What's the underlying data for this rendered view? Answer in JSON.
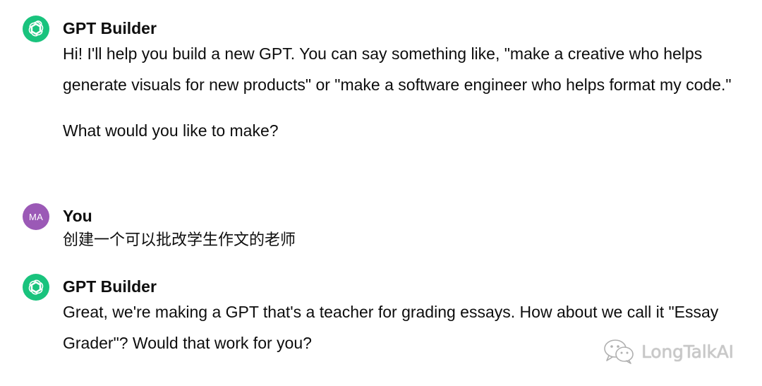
{
  "messages": [
    {
      "sender": "GPT Builder",
      "avatar_icon": "openai-logo-icon",
      "paragraphs": [
        "Hi! I'll help you build a new GPT. You can say something like, \"make a creative who helps generate visuals for new products\" or \"make a software engineer who helps format my code.\"",
        "What would you like to make?"
      ]
    },
    {
      "sender": "You",
      "avatar_initials": "MA",
      "text": "创建一个可以批改学生作文的老师"
    },
    {
      "sender": "GPT Builder",
      "avatar_icon": "openai-logo-icon",
      "paragraphs": [
        "Great, we're making a GPT that's a teacher for grading essays. How about we call it \"Essay Grader\"? Would that work for you?"
      ]
    }
  ],
  "watermark": {
    "text": "LongTalkAI",
    "icon": "wechat-icon"
  },
  "colors": {
    "gpt_avatar": "#19c37d",
    "user_avatar": "#9b59b6",
    "text": "#0d0d0d"
  }
}
